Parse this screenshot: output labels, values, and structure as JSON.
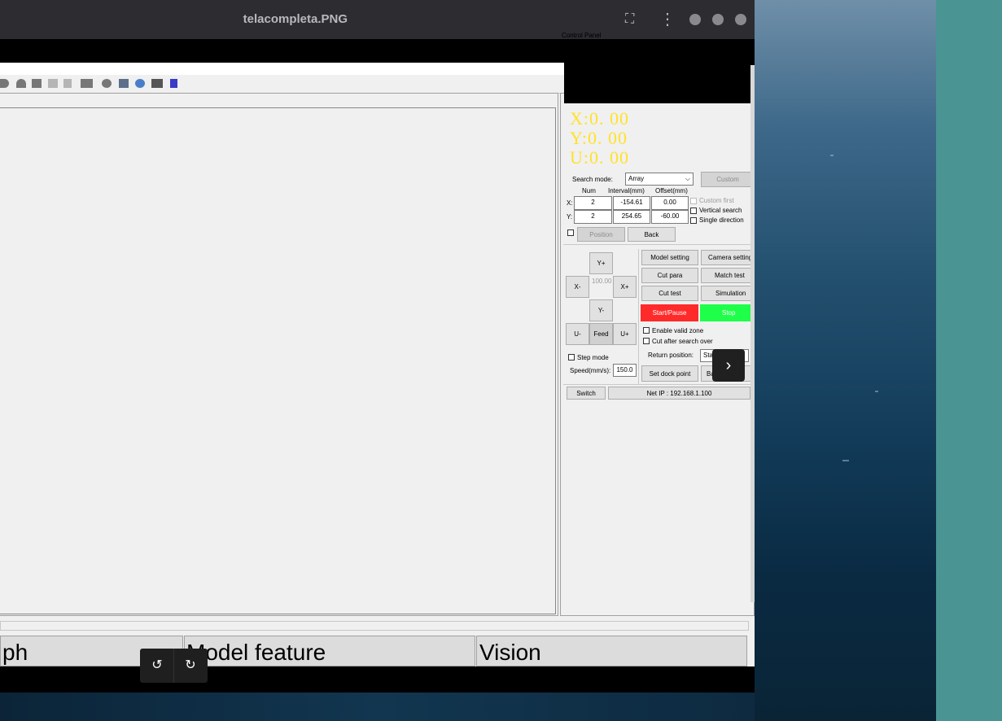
{
  "viewer": {
    "title": "telacompleta.PNG",
    "fullscreen_icon": "⛶",
    "menu_icon": "⋮",
    "next_icon": "›",
    "rotate_left_icon": "↺",
    "rotate_right_icon": "↻"
  },
  "app": {
    "window_controls": [
      "_",
      "🗗",
      "×"
    ],
    "control_panel_title": "Control Panel",
    "coords": {
      "x": "X:0. 00",
      "y": "Y:0. 00",
      "u": "U:0. 00"
    },
    "search": {
      "mode_label": "Search mode:",
      "mode_value": "Array",
      "custom_button": "Custom",
      "col_num": "Num",
      "col_interval": "Interval(mm)",
      "col_offset": "Offset(mm)",
      "row_x_label": "X:",
      "row_y_label": "Y:",
      "x_num": "2",
      "x_interval": "-154.61",
      "x_offset": "0.00",
      "y_num": "2",
      "y_interval": "254.65",
      "y_offset": "-60.00",
      "custom_first": "Custom first",
      "vertical_search": "Vertical search",
      "single_direction": "Single direction",
      "position_button": "Position",
      "back_button": "Back"
    },
    "jog": {
      "y_plus": "Y+",
      "y_minus": "Y-",
      "x_minus": "X-",
      "x_plus": "X+",
      "step_value": "100.00",
      "u_minus": "U-",
      "feed": "Feed",
      "u_plus": "U+",
      "step_mode": "Step mode",
      "speed_label": "Speed(mm/s):",
      "speed_value": "150.0"
    },
    "actions": {
      "model_setting": "Model setting",
      "camera_setting": "Camera setting",
      "cut_para": "Cut para",
      "match_test": "Match test",
      "cut_test": "Cut test",
      "simulation": "Simulation",
      "start_pause": "Start/Pause",
      "stop": "Stop",
      "enable_valid_zone": "Enable valid zone",
      "cut_after_search": "Cut after search over",
      "return_position_label": "Return position:",
      "return_position_value": "Sta",
      "set_dock_point": "Set dock point",
      "back_origin": "Back orig",
      "switch": "Switch",
      "net_ip": "Net IP : 192.168.1.100"
    },
    "colors": {
      "start": "#ff2a2a",
      "stop": "#1eff4a",
      "coord": "#ffe22a"
    },
    "bottom_tabs": [
      "ph",
      "Model feature",
      "Vision"
    ]
  }
}
